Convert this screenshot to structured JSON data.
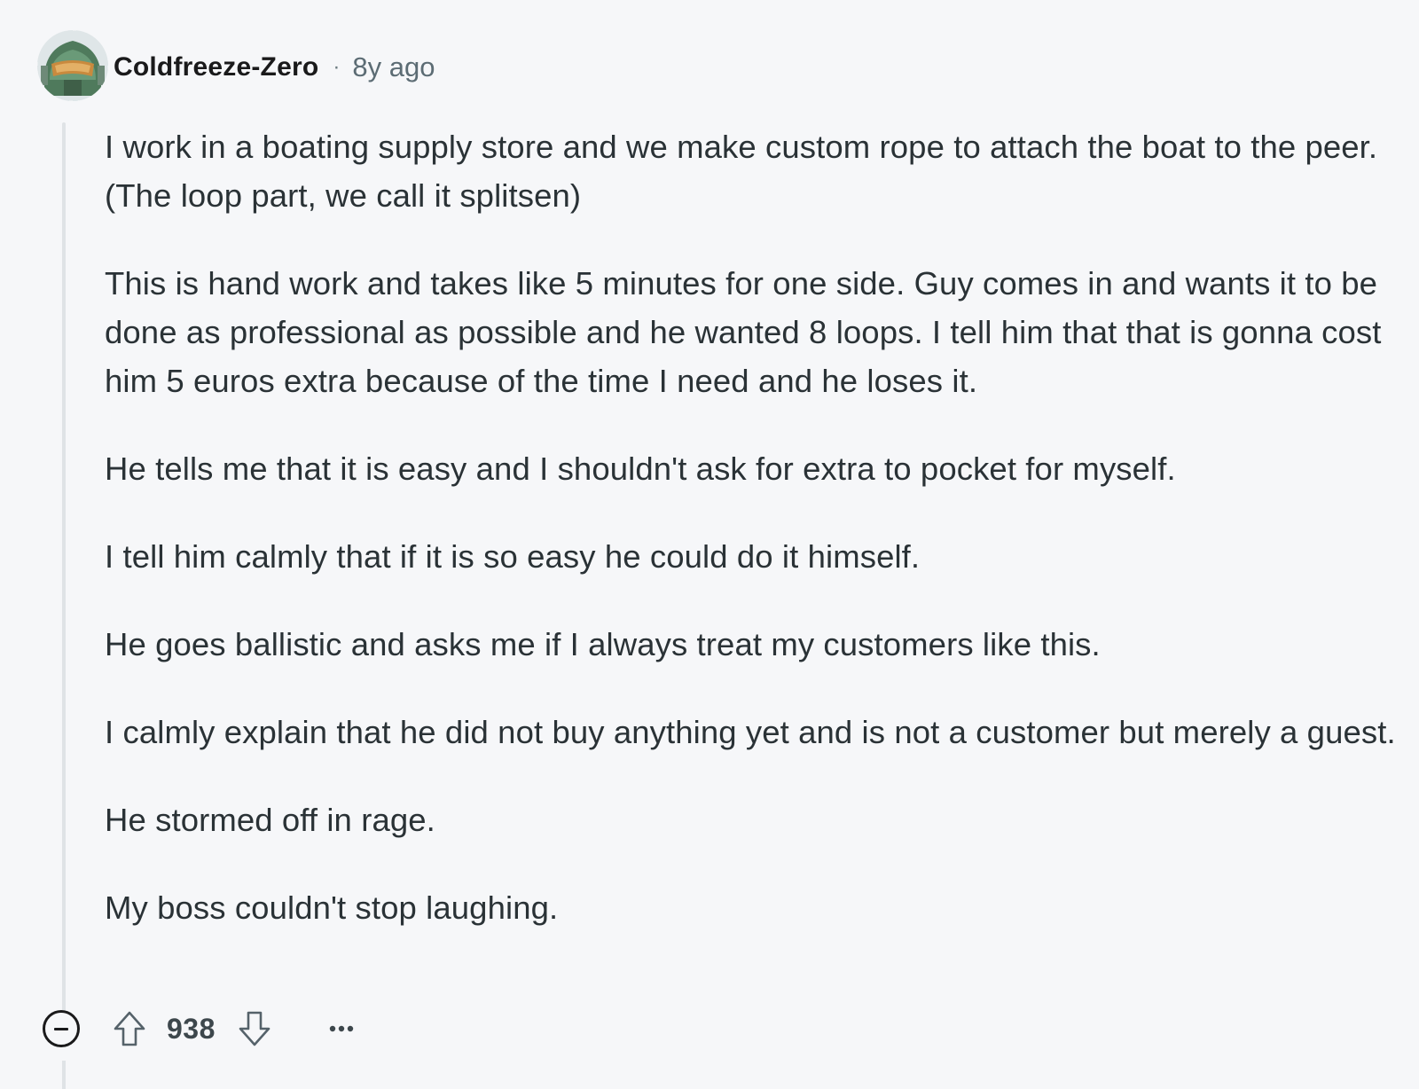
{
  "comment": {
    "username": "Coldfreeze-Zero",
    "separator": "·",
    "age": "8y ago",
    "avatar_icon": "helmet-avatar-icon",
    "paragraphs": [
      "I work in a boating supply store and we make custom rope to attach the boat to the peer. (The loop part, we call it splitsen)",
      "This is hand work and takes like 5 minutes for one side. Guy comes in and wants it to be done as professional as possible and he wanted 8 loops. I tell him that that is gonna cost him 5 euros extra because of the time I need and he loses it.",
      "He tells me that it is easy and I shouldn't ask for extra to pocket for myself.",
      "I tell him calmly that if it is so easy he could do it himself.",
      "He goes ballistic and asks me if I always treat my customers like this.",
      "I calmly explain that he did not buy anything yet and is not a customer but merely a guest.",
      "He stormed off in rage.",
      "My boss couldn't stop laughing."
    ]
  },
  "actions": {
    "score": "938",
    "collapse_icon": "collapse-minus-icon",
    "upvote_icon": "arrow-up-icon",
    "downvote_icon": "arrow-down-icon",
    "more_icon": "more-options-icon"
  },
  "colors": {
    "background": "#f6f7f9",
    "text": "#2a3236",
    "username": "#1a1a1b",
    "meta": "#5c6c74",
    "thread_line": "#dfe3e6"
  }
}
